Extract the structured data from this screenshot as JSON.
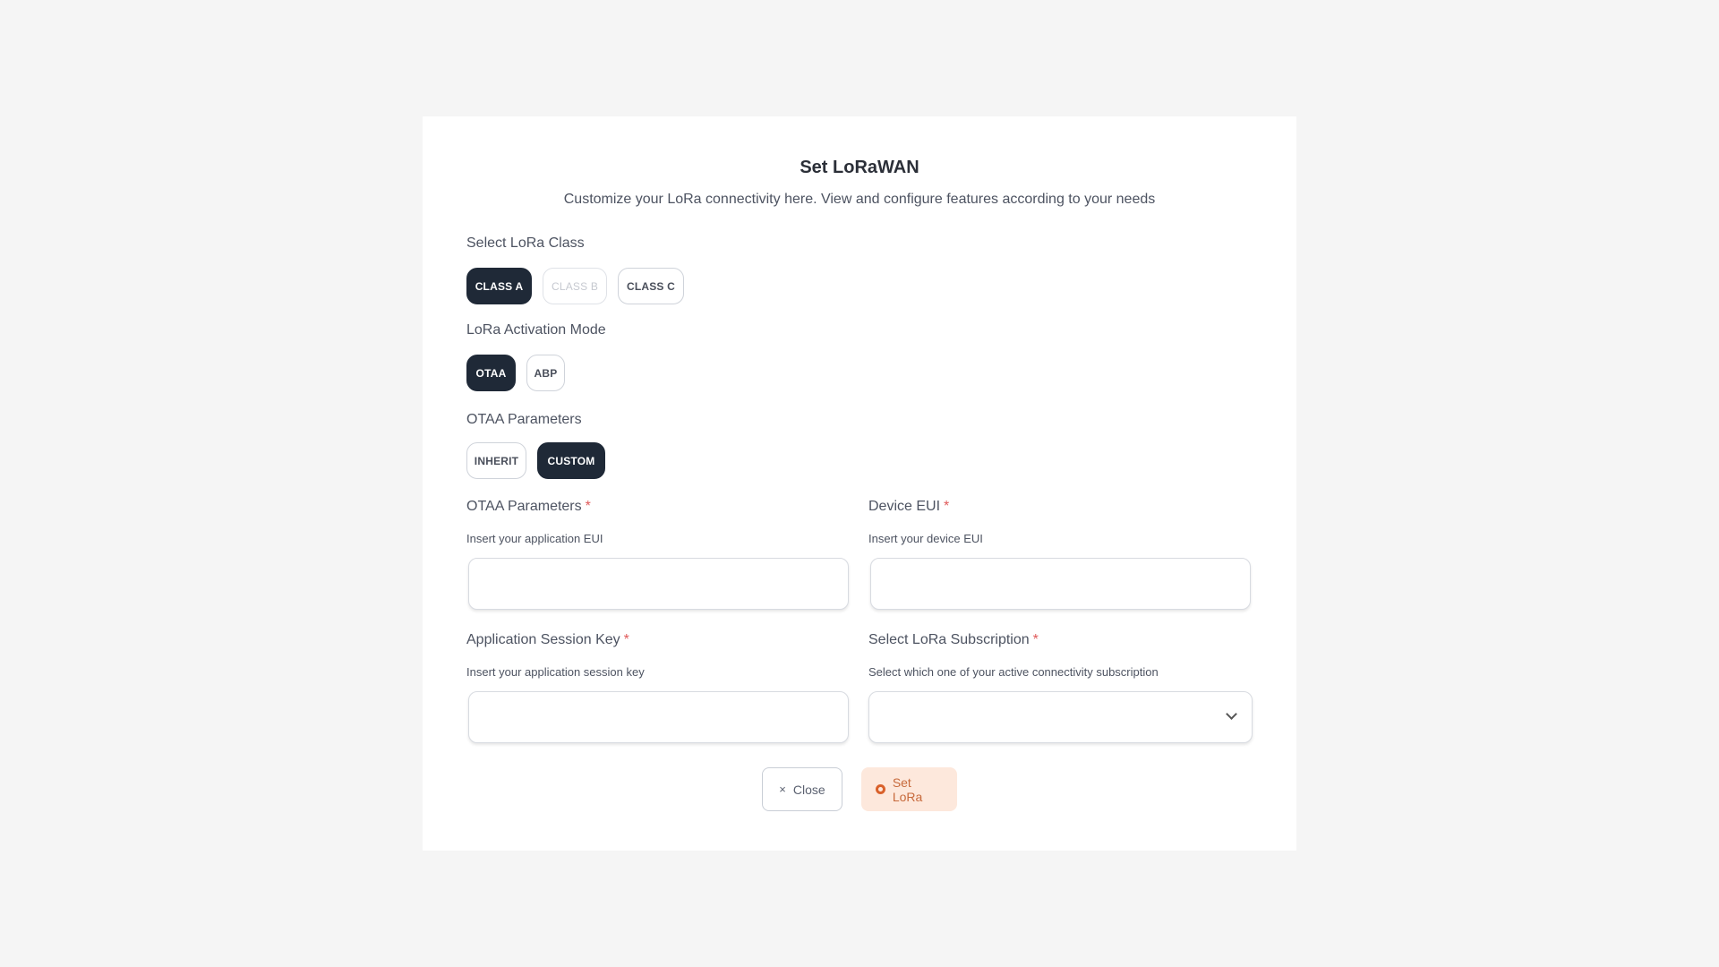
{
  "modal": {
    "title": "Set LoRaWAN",
    "subtitle": "Customize your LoRa connectivity here. View and configure features according to your needs"
  },
  "class_section": {
    "label": "Select LoRa Class",
    "options": [
      {
        "label": "CLASS A",
        "state": "selected"
      },
      {
        "label": "CLASS B",
        "state": "disabled"
      },
      {
        "label": "CLASS C",
        "state": "default"
      }
    ]
  },
  "activation_section": {
    "label": "LoRa Activation Mode",
    "options": [
      {
        "label": "OTAA",
        "state": "selected"
      },
      {
        "label": "ABP",
        "state": "default"
      }
    ]
  },
  "otaa_section": {
    "label": "OTAA Parameters",
    "options": [
      {
        "label": "INHERIT",
        "state": "default"
      },
      {
        "label": "CUSTOM",
        "state": "selected"
      }
    ]
  },
  "fields": {
    "app_eui": {
      "label": "OTAA Parameters",
      "required_mark": "*",
      "hint": "Insert your application EUI",
      "value": "",
      "placeholder": ""
    },
    "device_eui": {
      "label": "Device EUI",
      "required_mark": "*",
      "hint": "Insert your device EUI",
      "value": "",
      "placeholder": ""
    },
    "app_session_key": {
      "label": "Application Session Key",
      "required_mark": "*",
      "hint": "Insert your application session key",
      "value": "",
      "placeholder": ""
    },
    "subscription": {
      "label": "Select LoRa Subscription",
      "required_mark": "*",
      "hint": "Select which one of your active connectivity subscription",
      "selected": ""
    }
  },
  "actions": {
    "close_label": "Close",
    "close_icon": "×",
    "set_label": "Set LoRa"
  },
  "colors": {
    "page_bg": "#f5f5f5",
    "selected_pill": "#1f2937",
    "required": "#e05a5a",
    "set_button_bg": "#fde8dc",
    "set_button_text": "#c76a3c"
  }
}
